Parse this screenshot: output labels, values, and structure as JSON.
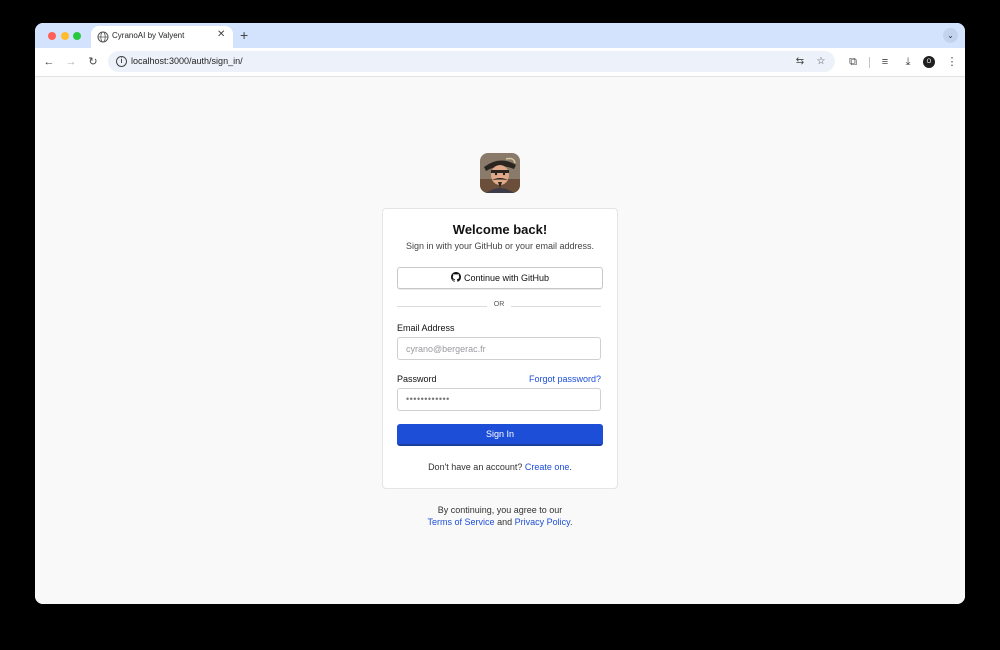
{
  "browser": {
    "tab_title": "CyranoAI by Valyent",
    "tab_close": "✕",
    "new_tab": "+",
    "url": "localhost:3000/auth/sign_in/",
    "profile_initial": "O"
  },
  "card": {
    "title": "Welcome back!",
    "subtitle": "Sign in with your GitHub or your email address.",
    "github_button": "Continue with GitHub",
    "divider": "OR",
    "email_label": "Email Address",
    "email_placeholder": "cyrano@bergerac.fr",
    "password_label": "Password",
    "forgot_password": "Forgot password?",
    "password_value": "••••••••••••",
    "signin_button": "Sign In",
    "no_account_text": "Don't have an account?",
    "create_link": "Create one",
    "period": "."
  },
  "footer": {
    "line1": "By continuing, you agree to our",
    "terms": "Terms of Service",
    "and": "and",
    "privacy": "Privacy Policy",
    "period": "."
  },
  "colors": {
    "accent": "#1d4ed8",
    "tabstrip": "#d3e3fd",
    "page_bg": "#f9f9f9"
  },
  "icons": [
    "globe-icon",
    "close-icon",
    "plus-icon",
    "back-icon",
    "forward-icon",
    "reload-icon",
    "info-icon",
    "translate-icon",
    "star-icon",
    "extensions-icon",
    "media-icon",
    "download-icon",
    "profile-icon",
    "menu-icon",
    "github-icon"
  ]
}
